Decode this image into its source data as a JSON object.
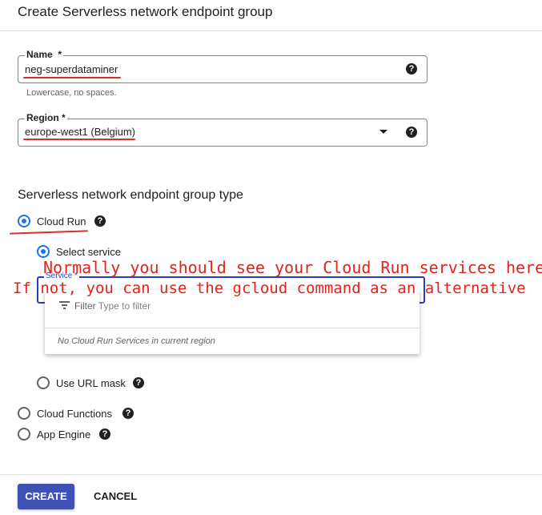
{
  "page": {
    "title": "Create Serverless network endpoint group"
  },
  "name_field": {
    "label": "Name",
    "required_mark": "*",
    "value": "neg-superdataminer",
    "hint": "Lowercase, no spaces.",
    "help_icon": "question-circle-icon"
  },
  "region_field": {
    "label": "Region",
    "required_mark": "*",
    "value": "europe-west1 (Belgium)",
    "dropdown_icon": "triangle-down-icon",
    "help_icon": "question-circle-icon"
  },
  "endpoint_type": {
    "title": "Serverless network endpoint group type",
    "options": [
      {
        "label": "Cloud Run",
        "checked": true
      },
      {
        "label": "Cloud Functions",
        "checked": false
      },
      {
        "label": "App Engine",
        "checked": false
      }
    ]
  },
  "cloud_run": {
    "select_service_label": "Select service",
    "service_label": "Service *",
    "filter_label": "Filter",
    "filter_placeholder": "Type to filter",
    "no_services_message": "No Cloud Run Services in current region",
    "url_mask_label": "Use URL mask"
  },
  "annotations": {
    "line1": "Normally you should see your Cloud Run services here",
    "line2": "If not, you can use the gcloud command as an alternative",
    "color": "#e0241b"
  },
  "actions": {
    "create_label": "CREATE",
    "cancel_label": "CANCEL"
  },
  "colors": {
    "accent": "#1a73e8",
    "primary_button": "#3f51b5",
    "annotation_red": "#d93025",
    "annotation_blue": "#2b3cc4"
  }
}
